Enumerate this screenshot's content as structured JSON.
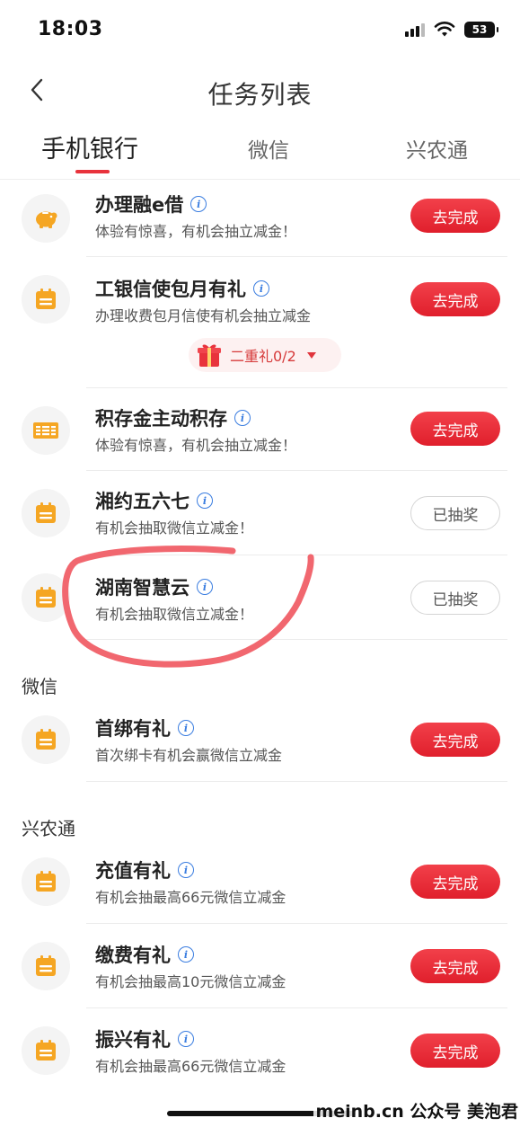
{
  "status_bar": {
    "time": "18:03",
    "battery": "53"
  },
  "header": {
    "title": "任务列表"
  },
  "tabs": [
    {
      "label": "手机银行",
      "active": true
    },
    {
      "label": "微信",
      "active": false
    },
    {
      "label": "兴农通",
      "active": false
    }
  ],
  "mobile_bank_tasks": [
    {
      "title": "办理融e借",
      "desc": "体验有惊喜，有机会抽立减金！",
      "button": "去完成",
      "icon": "piggy-bank-icon"
    },
    {
      "title": "工银信使包月有礼",
      "desc": "办理收费包月信使有机会抽立减金",
      "button": "去完成",
      "icon": "calendar-icon"
    },
    {
      "title": "积存金主动积存",
      "desc": "体验有惊喜，有机会抽立减金！",
      "button": "去完成",
      "icon": "gold-bar-icon"
    },
    {
      "title": "湘约五六七",
      "desc": "有机会抽取微信立减金！",
      "button": "已抽奖",
      "icon": "calendar-icon"
    },
    {
      "title": "湖南智慧云",
      "desc": "有机会抽取微信立减金！",
      "button": "已抽奖",
      "icon": "calendar-icon"
    }
  ],
  "gift_badge": {
    "text": "二重礼0/2"
  },
  "sections": {
    "wechat": "微信",
    "xingnongtong": "兴农通"
  },
  "wechat_tasks": [
    {
      "title": "首绑有礼",
      "desc": "首次绑卡有机会赢微信立减金",
      "button": "去完成",
      "icon": "calendar-icon"
    }
  ],
  "xingnongtong_tasks": [
    {
      "title": "充值有礼",
      "desc": "有机会抽最高66元微信立减金",
      "button": "去完成",
      "icon": "calendar-icon"
    },
    {
      "title": "缴费有礼",
      "desc": "有机会抽最高10元微信立减金",
      "button": "去完成",
      "icon": "calendar-icon"
    },
    {
      "title": "振兴有礼",
      "desc": "有机会抽最高66元微信立减金",
      "button": "去完成",
      "icon": "calendar-icon"
    }
  ],
  "info_glyph": "i",
  "watermark": "meinb.cn  公众号 美泡君",
  "colors": {
    "accent_red": "#e8333c",
    "icon_orange": "#f5a623",
    "info_blue": "#3a7de0"
  }
}
